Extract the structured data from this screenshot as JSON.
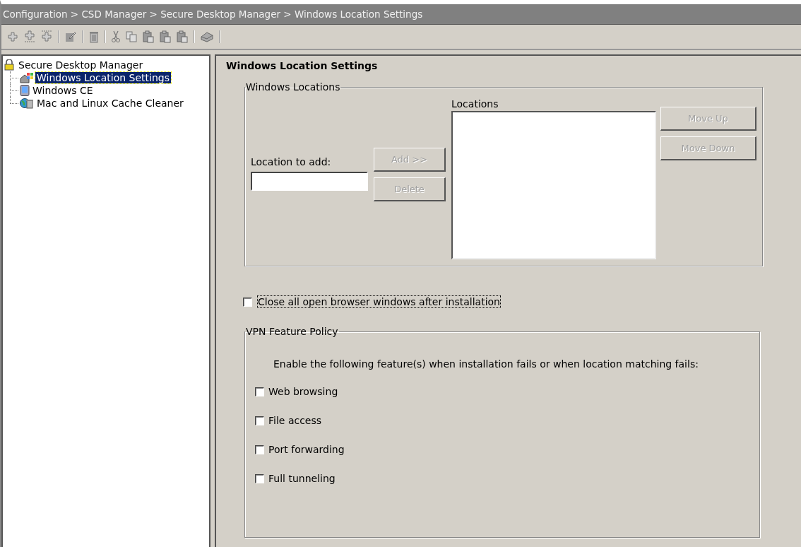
{
  "breadcrumb": "Configuration > CSD Manager > Secure Desktop Manager > Windows Location Settings",
  "tree": {
    "label": "Secure Desktop Manager",
    "selected": false,
    "children": [
      {
        "label": "Windows Location Settings",
        "selected": true,
        "kind": "windows"
      },
      {
        "label": "Windows CE",
        "selected": false,
        "kind": "device"
      },
      {
        "label": "Mac and Linux Cache Cleaner",
        "selected": false,
        "kind": "cleaner"
      }
    ]
  },
  "panel": {
    "title": "Windows Location Settings",
    "locations_group": {
      "legend": "Windows Locations",
      "field_label": "Location to add:",
      "list_label": "Locations",
      "add_button": {
        "label": "Add >>",
        "disabled": true
      },
      "delete_button": {
        "label": "Delete",
        "disabled": true
      },
      "move_up_button": {
        "label": "Move Up",
        "disabled": true
      },
      "move_down_button": {
        "label": "Move Down",
        "disabled": true
      }
    },
    "close_browsers": {
      "label": "Close all open browser windows after installation",
      "checked": false
    },
    "policy_group": {
      "legend": "VPN Feature Policy",
      "description": "Enable the following feature(s) when installation fails or when location matching fails:",
      "features": [
        {
          "label": "Web browsing",
          "checked": false
        },
        {
          "label": "File access",
          "checked": false
        },
        {
          "label": "Port forwarding",
          "checked": false
        },
        {
          "label": "Full tunneling",
          "checked": false
        }
      ]
    }
  }
}
